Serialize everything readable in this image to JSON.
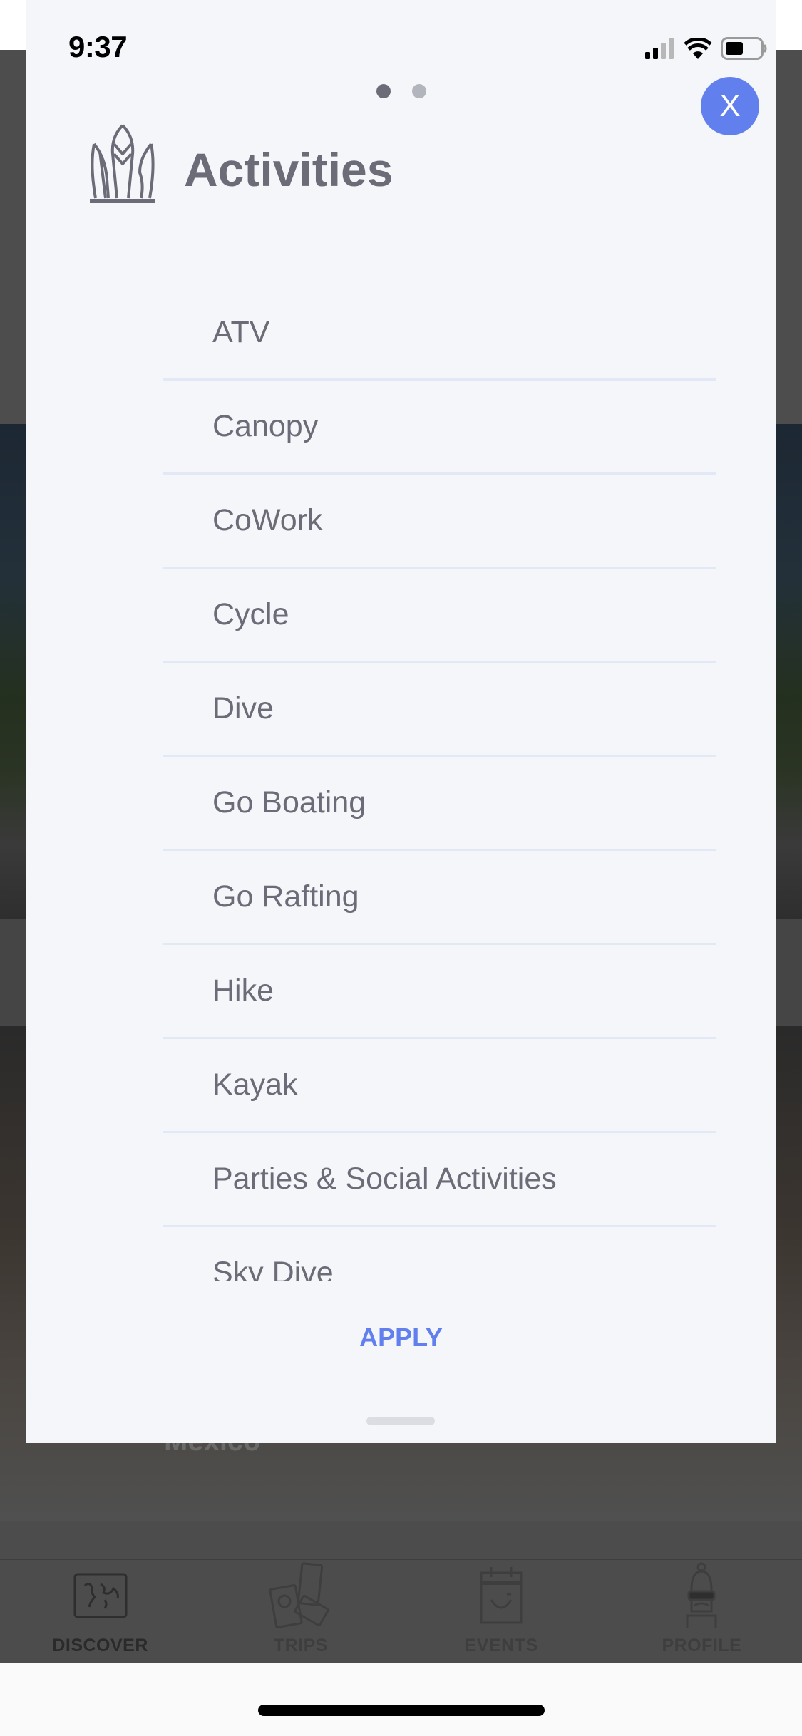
{
  "status_bar": {
    "time": "9:37",
    "signal_icon": "cellular-signal-icon",
    "wifi_icon": "wifi-icon",
    "battery_icon": "battery-icon"
  },
  "background": {
    "caption": "Mexico"
  },
  "modal": {
    "page_indicator": {
      "total": 2,
      "current": 1
    },
    "close_label": "X",
    "header_icon": "leaves-plant-icon",
    "title": "Activities",
    "items": [
      {
        "label": "ATV"
      },
      {
        "label": "Canopy"
      },
      {
        "label": "CoWork"
      },
      {
        "label": "Cycle"
      },
      {
        "label": "Dive"
      },
      {
        "label": "Go Boating"
      },
      {
        "label": "Go Rafting"
      },
      {
        "label": "Hike"
      },
      {
        "label": "Kayak"
      },
      {
        "label": "Parties & Social Activities"
      },
      {
        "label": "Sky Dive"
      }
    ],
    "apply_label": "APPLY"
  },
  "tabbar": {
    "tabs": [
      {
        "label": "DISCOVER",
        "icon": "world-map-icon",
        "active": true
      },
      {
        "label": "TRIPS",
        "icon": "passport-tickets-icon",
        "active": false
      },
      {
        "label": "EVENTS",
        "icon": "calendar-smile-icon",
        "active": false
      },
      {
        "label": "PROFILE",
        "icon": "avatar-sunglasses-icon",
        "active": false
      }
    ]
  },
  "colors": {
    "accent": "#6180ee",
    "text_muted": "#6b6c78",
    "modal_bg": "#f5f6fa",
    "divider": "#e2e8f5"
  }
}
